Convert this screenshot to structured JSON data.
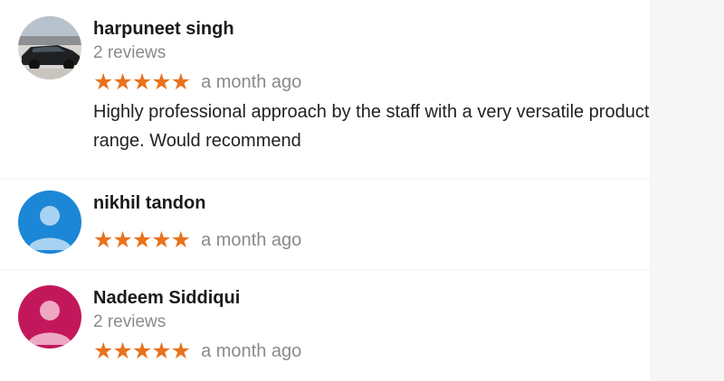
{
  "reviews": [
    {
      "name": "harpuneet singh",
      "review_count": "2 reviews",
      "stars": "★★★★★",
      "rating": 5,
      "time_ago": "a month ago",
      "text": "Highly professional approach by the staff with a very versatile product range. Would recommend",
      "avatar_type": "photo-car"
    },
    {
      "name": "nikhil tandon",
      "review_count": "",
      "stars": "★★★★★",
      "rating": 5,
      "time_ago": "a month ago",
      "text": "",
      "avatar_type": "default-person-icon",
      "avatar_color": "#1b87d6"
    },
    {
      "name": "Nadeem Siddiqui",
      "review_count": "2 reviews",
      "stars": "★★★★★",
      "rating": 5,
      "time_ago": "a month ago",
      "text": "",
      "avatar_type": "default-person-icon",
      "avatar_color": "#c2185b"
    }
  ],
  "colors": {
    "star": "#e8721d",
    "muted_text": "#8a8a8a",
    "name_text": "#1a1a1a"
  }
}
